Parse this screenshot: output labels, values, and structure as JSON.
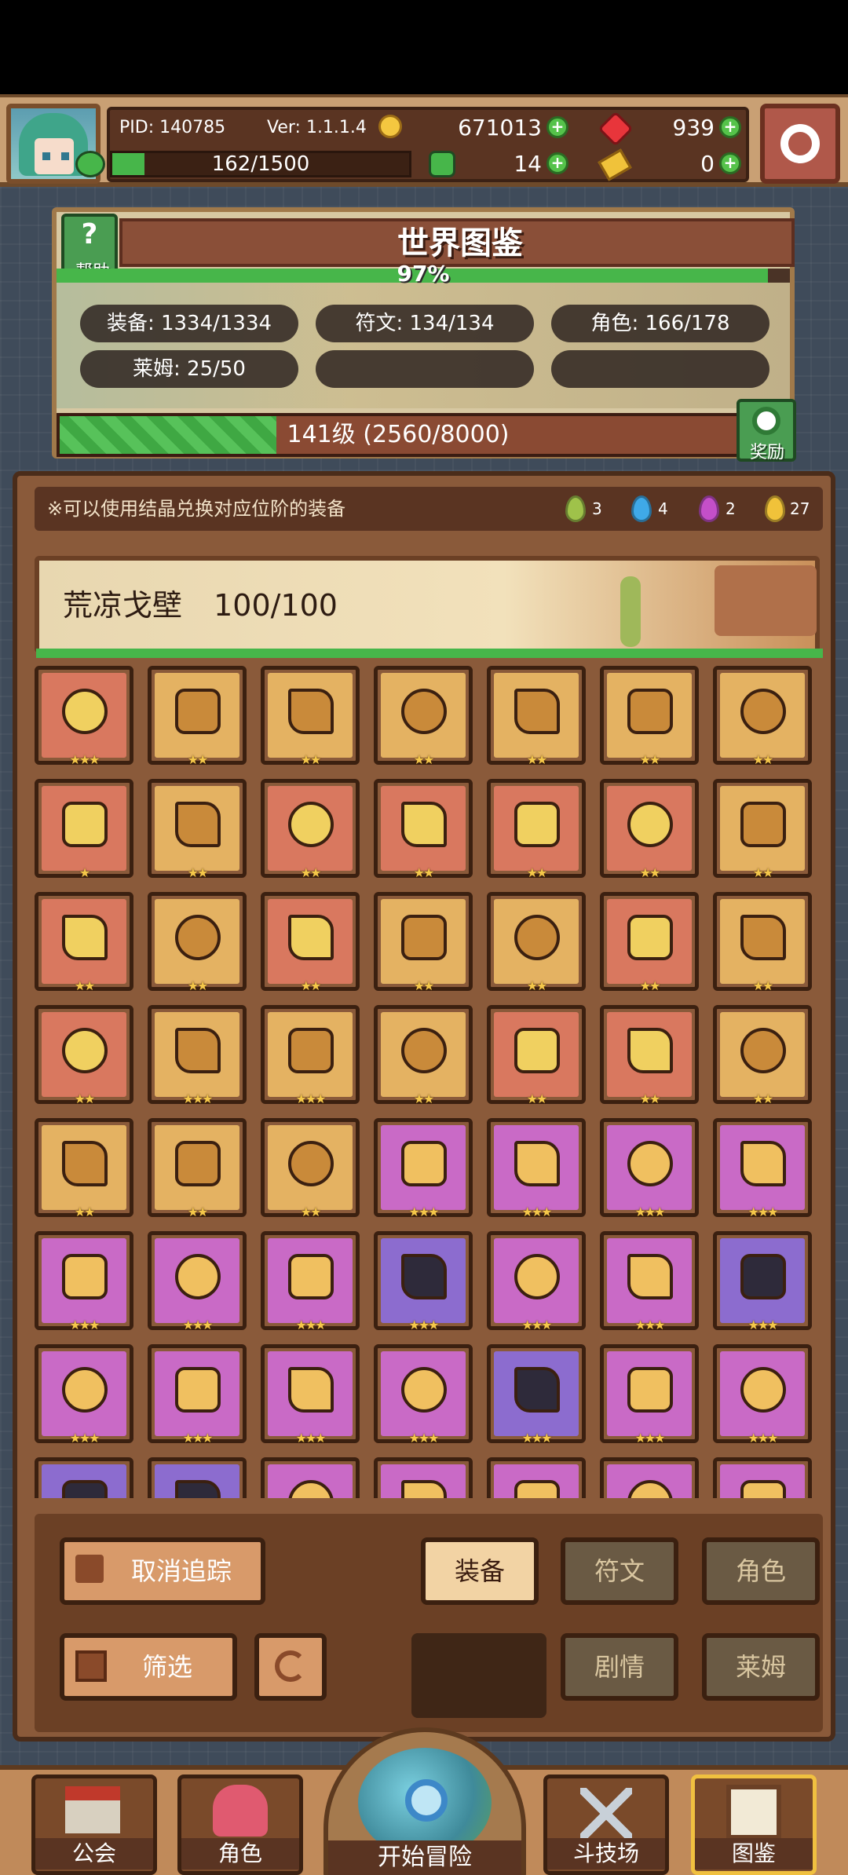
{
  "top": {
    "pid": "PID: 140785",
    "version": "Ver: 1.1.1.4",
    "gold": "671013",
    "ruby": "939",
    "energy": "162/1500",
    "clover": "14",
    "ticket": "0",
    "energy_fraction": 0.108
  },
  "atlas": {
    "title": "世界图鉴",
    "help_label": "帮助",
    "percent": "97%",
    "percent_value": 0.97,
    "stats": [
      "装备: 1334/1334",
      "符文: 134/134",
      "角色: 166/178",
      "莱姆: 25/50"
    ],
    "level": "141级  (2560/8000)",
    "level_fraction": 0.32,
    "reward_label": "奖励"
  },
  "hint": {
    "text": "※可以使用结晶兑换对应位阶的装备",
    "gems": [
      {
        "color": "#9fc24a",
        "count": "3"
      },
      {
        "color": "#3fa9e8",
        "count": "4"
      },
      {
        "color": "#c44fc9",
        "count": "2"
      },
      {
        "color": "#f0c23a",
        "count": "27"
      }
    ]
  },
  "region": {
    "name": "荒凉戈壁",
    "progress": "100/100"
  },
  "grid": [
    [
      "red",
      "gold",
      "gold",
      "gold",
      "gold",
      "gold",
      "gold"
    ],
    [
      "red",
      "gold",
      "red",
      "red",
      "red",
      "red",
      "gold"
    ],
    [
      "red",
      "gold",
      "red",
      "gold",
      "gold",
      "red",
      "gold"
    ],
    [
      "red",
      "gold",
      "gold",
      "gold",
      "red",
      "red",
      "gold"
    ],
    [
      "gold",
      "gold",
      "gold",
      "pink",
      "pink",
      "pink",
      "pink"
    ],
    [
      "pink",
      "pink",
      "pink",
      "violet",
      "pink",
      "pink",
      "violet"
    ],
    [
      "pink",
      "pink",
      "pink",
      "pink",
      "violet",
      "pink",
      "pink"
    ],
    [
      "violet",
      "violet",
      "pink",
      "pink",
      "pink",
      "pink",
      "pink"
    ]
  ],
  "stars": [
    [
      "★★★",
      "★★",
      "★★",
      "★★",
      "★★",
      "★★",
      "★★"
    ],
    [
      "★",
      "★★",
      "★★",
      "★★",
      "★★",
      "★★",
      "★★"
    ],
    [
      "★★",
      "★★",
      "★★",
      "★★",
      "★★",
      "★★",
      "★★"
    ],
    [
      "★★",
      "★★★",
      "★★★",
      "★★",
      "★★",
      "★★",
      "★★"
    ],
    [
      "★★",
      "★★",
      "★★",
      "★★★",
      "★★★",
      "★★★",
      "★★★"
    ],
    [
      "★★★",
      "★★★",
      "★★★",
      "★★★",
      "★★★",
      "★★★",
      "★★★"
    ],
    [
      "★★★",
      "★★★",
      "★★★",
      "★★★",
      "★★★",
      "★★★",
      "★★★"
    ],
    [
      "",
      "",
      "",
      "",
      "",
      "",
      ""
    ]
  ],
  "buttons": {
    "untrack": "取消追踪",
    "filter": "筛选",
    "equipment": "装备",
    "rune": "符文",
    "character": "角色",
    "story": "剧情",
    "lime": "莱姆"
  },
  "nav": {
    "guild": "公会",
    "character": "角色",
    "adventure": "开始冒险",
    "arena": "斗技场",
    "atlas": "图鉴"
  },
  "colors": {
    "green": "#47b64a",
    "panel_brown": "#8a5a3a",
    "red_cell": "#d9785f",
    "gold_cell": "#e4b262",
    "pink_cell": "#c96ac6",
    "violet_cell": "#8c6ccf"
  }
}
